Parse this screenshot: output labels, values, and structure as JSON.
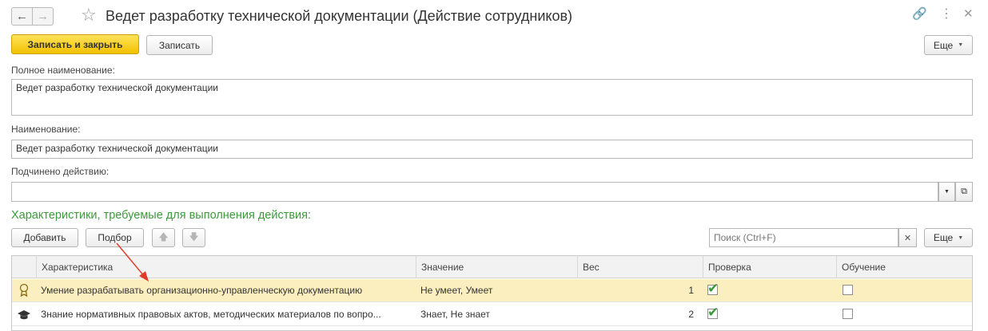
{
  "window": {
    "title": "Ведет разработку технической документации (Действие сотрудников)"
  },
  "toolbar": {
    "save_close": "Записать и закрыть",
    "save": "Записать",
    "more": "Еще"
  },
  "form": {
    "full_name_label": "Полное наименование:",
    "full_name_value": "Ведет разработку технической документации",
    "name_label": "Наименование:",
    "name_value": "Ведет разработку технической документации",
    "parent_label": "Подчинено действию:",
    "parent_value": ""
  },
  "characteristics": {
    "section_title": "Характеристики, требуемые для выполнения действия:",
    "add": "Добавить",
    "pick": "Подбор",
    "search_placeholder": "Поиск (Ctrl+F)",
    "more": "Еще",
    "columns": [
      "Характеристика",
      "Значение",
      "Вес",
      "Проверка",
      "Обучение"
    ],
    "rows": [
      {
        "icon": "skill-badge-icon",
        "name": "Умение разрабатывать организационно-управленческую документацию",
        "value": "Не умеет, Умеет",
        "weight": "1",
        "check": true,
        "training": false
      },
      {
        "icon": "graduation-cap-icon",
        "name": "Знание нормативных правовых актов, методических материалов по вопро...",
        "value": "Знает, Не знает",
        "weight": "2",
        "check": true,
        "training": false
      }
    ]
  },
  "colors": {
    "accent": "#f2c200",
    "section_title": "#3c9a3c",
    "selected_row": "#fbefbf",
    "annotation_arrow": "#e03a2a"
  }
}
